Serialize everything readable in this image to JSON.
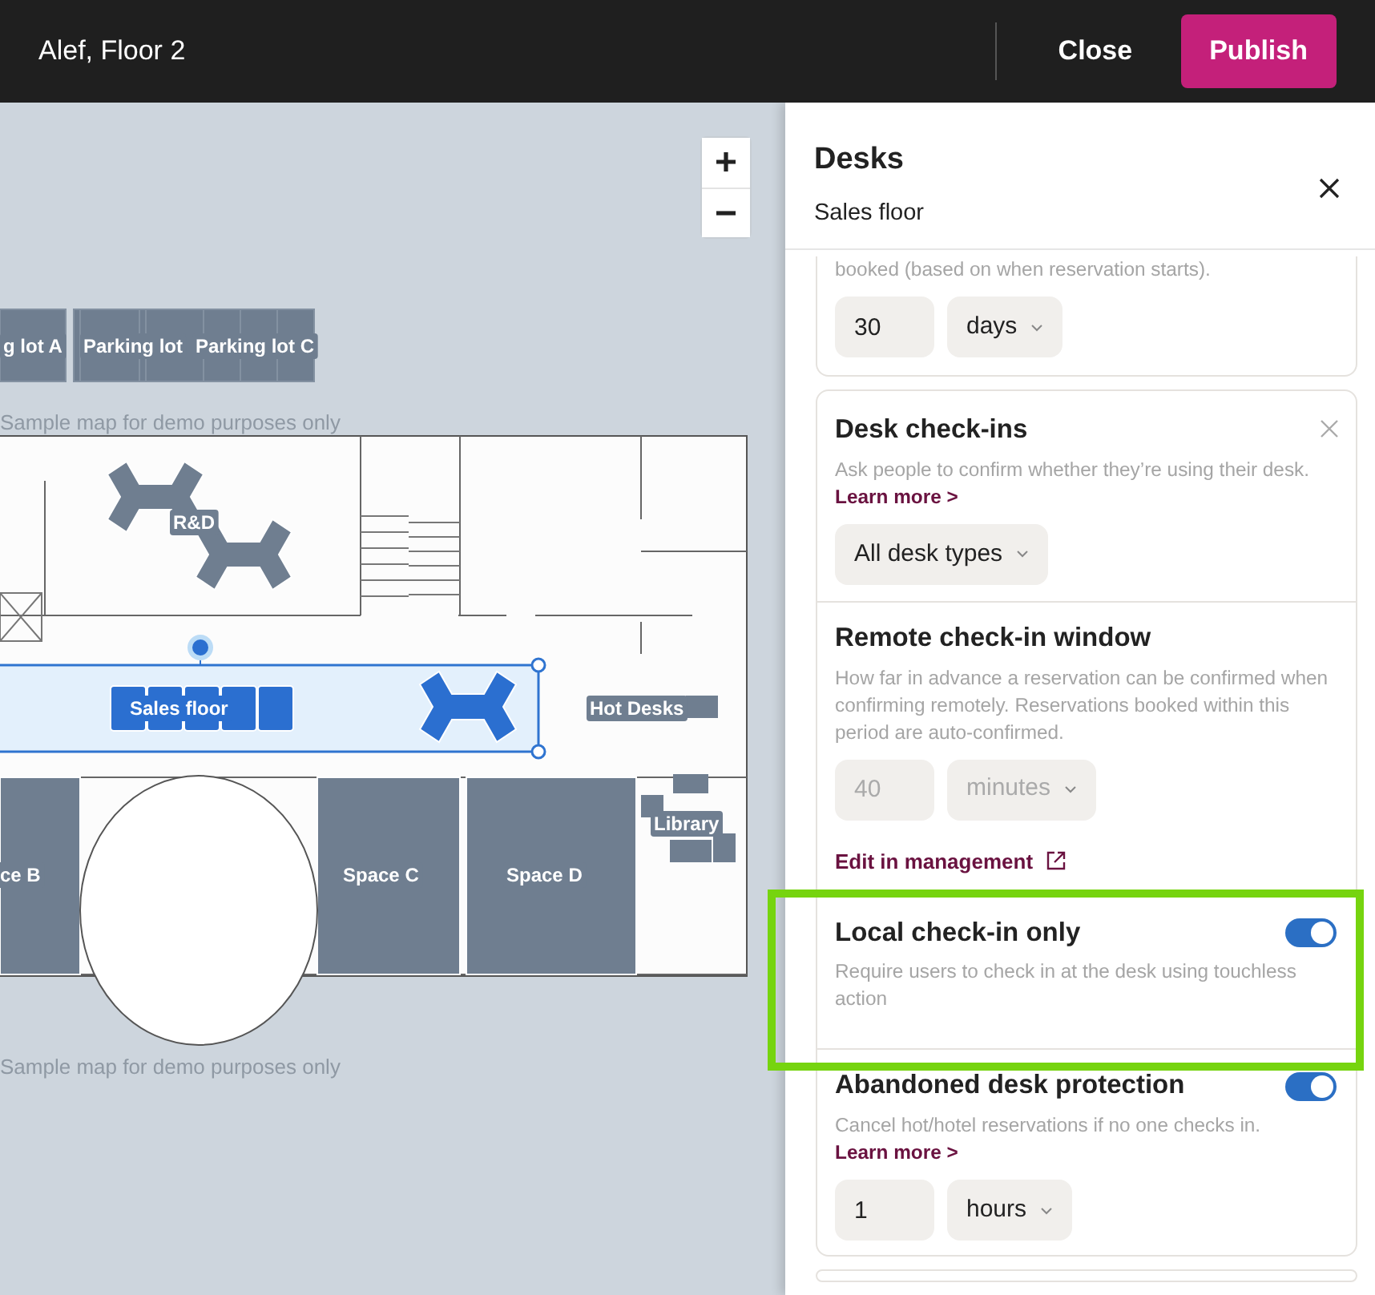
{
  "top_bar": {
    "title": "Alef, Floor 2",
    "buttons": [
      {
        "label": "Close",
        "kind": "plain"
      },
      {
        "label": "Publish",
        "kind": "primary"
      }
    ]
  },
  "map": {
    "parking_lots": [
      "g lot A",
      "Parking lot",
      "Parking lot C"
    ],
    "watermarks": [
      "Sample map for demo purposes only",
      "Sample map for demo purposes only"
    ],
    "rooms": [
      {
        "label": "R&D",
        "kind": "desks",
        "selected": false
      },
      {
        "label": "Sales floor",
        "kind": "desks",
        "selected": true
      },
      {
        "label": "Hot Desks",
        "kind": "desks",
        "selected": false
      },
      {
        "label": "Library",
        "kind": "desks",
        "selected": false
      },
      {
        "label": "ce B",
        "kind": "space",
        "selected": false
      },
      {
        "label": "Space C",
        "kind": "space",
        "selected": false
      },
      {
        "label": "Space D",
        "kind": "space",
        "selected": false
      }
    ]
  },
  "panel": {
    "title": "Desks",
    "subtitle": "Sales floor",
    "top_card": {
      "description": "booked (based on when reservation starts).",
      "value": "30",
      "unit": "days"
    },
    "card": {
      "title": "Desk check-ins",
      "removable": true,
      "description": "Ask people to confirm whether they’re using their desk.",
      "link": "Learn more >",
      "select": "All desk types",
      "subsections": [
        {
          "title": "Remote check-in window",
          "description": "How far in advance a reservation can be confirmed when confirming remotely. Reservations booked within this period are auto-confirmed.",
          "value": "40",
          "unit": "minutes",
          "disabled": true,
          "external_link": "Edit in management"
        },
        {
          "title": "Local check-in only",
          "on": true,
          "highlighted": true,
          "description": "Require users to check in at the desk using touchless action"
        },
        {
          "title": "Abandoned desk protection",
          "on": true,
          "description": "Cancel hot/hotel reservations if no one checks in.",
          "link": "Learn more >",
          "value": "1",
          "unit": "hours"
        }
      ]
    }
  }
}
